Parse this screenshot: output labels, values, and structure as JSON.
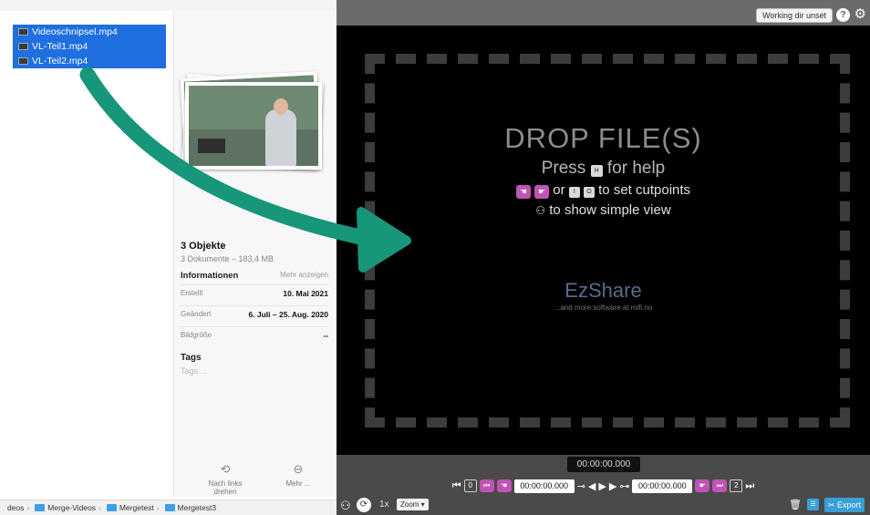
{
  "finder": {
    "files": [
      "Videoschnipsel.mp4",
      "VL-Teil1.mp4",
      "VL-Teil2.mp4"
    ],
    "summary_title": "3 Objekte",
    "summary_sub": "3 Dokumente – 183,4 MB",
    "info_header": "Informationen",
    "more_link": "Mehr anzeigen",
    "rows": [
      {
        "key": "Erstellt",
        "value": "10. Mai 2021"
      },
      {
        "key": "Geändert",
        "value": "6. Juli – 25. Aug. 2020"
      },
      {
        "key": "Bildgröße",
        "value": "--"
      }
    ],
    "tags_label": "Tags",
    "tags_placeholder": "Tags ...",
    "actions": [
      {
        "label": "Nach links drehen",
        "icon": "rotate-left-icon"
      },
      {
        "label": "Mehr ...",
        "icon": "more-icon"
      }
    ],
    "path": [
      "deos",
      "Merge-Videos",
      "Mergetest",
      "Mergetest3"
    ]
  },
  "app": {
    "working_dir": "Working dir unset",
    "help_symbol": "?",
    "settings_symbol": "⚙",
    "drop_title": "DROP FILE(S)",
    "help_prefix": "Press",
    "help_key": "H",
    "help_suffix": "for help",
    "cut_keys": [
      "☚",
      "☛"
    ],
    "cut_or": "or",
    "cut_key_i": "I",
    "cut_key_o": "O",
    "cut_suffix": "to set cutpoints",
    "simple_icon": "⚇",
    "simple_text": "to show simple view",
    "brand_name": "EzShare",
    "brand_sub": "...and more software at mifi.no",
    "current_time": "00:00:00.000",
    "start_time": "00:00:00.000",
    "end_time": "00:00:00.000",
    "start_segment": "0",
    "end_segment": "2",
    "speed": "1x",
    "zoom": "Zoom",
    "export": "Export"
  },
  "colors": {
    "accent_pink": "#c152b6",
    "accent_blue": "#3a9ed8",
    "arrow_green": "#17967a",
    "selection_blue": "#1f6fe0"
  }
}
